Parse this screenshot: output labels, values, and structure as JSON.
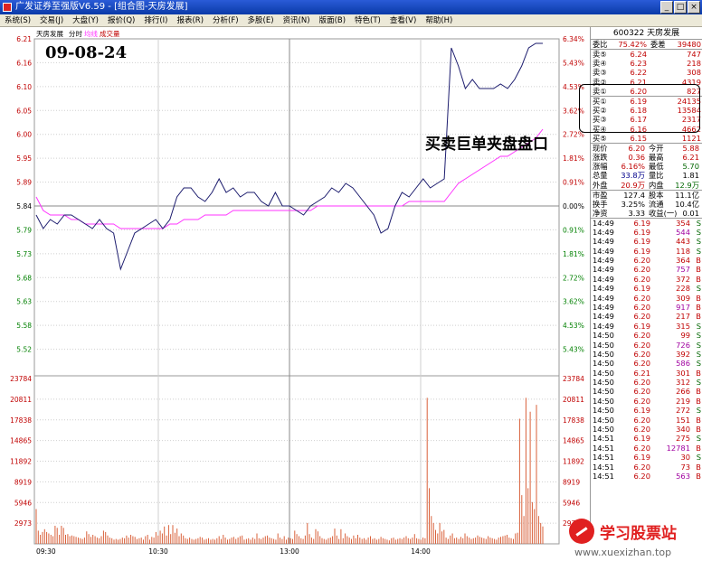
{
  "window": {
    "title": "广发证券至强版V6.59 - [组合图-天房发展]",
    "min": "_",
    "max": "□",
    "close": "×"
  },
  "menu": [
    "系统(S)",
    "交易(J)",
    "大盘(Y)",
    "报价(Q)",
    "排行(I)",
    "报表(R)",
    "分析(F)",
    "多股(E)",
    "资讯(N)",
    "版面(B)",
    "特色(T)",
    "查看(V)",
    "帮助(H)"
  ],
  "chart": {
    "stock_label": "天房发展",
    "tab_fenshi": "分时",
    "tab_junxian": "均线",
    "tab_volume": "成交量",
    "date_annotation": "09-08-24",
    "callout": "买卖巨单夹盘盘口",
    "price_labels": [
      "6.21",
      "6.16",
      "6.10",
      "6.05",
      "6.00",
      "5.95",
      "5.89",
      "5.84",
      "5.79",
      "5.73",
      "5.68",
      "5.63",
      "5.58",
      "5.52"
    ],
    "pct_labels": [
      "6.34%",
      "5.43%",
      "4.53%",
      "3.62%",
      "2.72%",
      "1.81%",
      "0.91%",
      "0.00%",
      "0.91%",
      "1.81%",
      "2.72%",
      "3.62%",
      "4.53%",
      "5.43%"
    ],
    "vol_labels": [
      "23784",
      "20811",
      "17838",
      "14865",
      "11892",
      "8919",
      "5946",
      "2973"
    ],
    "time_labels": [
      "09:30",
      "10:30",
      "13:00",
      "14:00"
    ],
    "colors": {
      "up": "#cc0000",
      "down": "#008000",
      "price_line": "#1c1c6e",
      "avg_line": "#ff33ff",
      "vol_bar": "#d9603a"
    }
  },
  "chart_data": {
    "type": "line",
    "x": [
      "09:30",
      "10:30",
      "13:00",
      "14:00",
      "15:00"
    ],
    "y_price_range": [
      5.47,
      6.21
    ],
    "prev_close": 5.84,
    "series": [
      {
        "values": [
          5.82,
          5.79,
          5.81,
          5.8,
          5.82,
          5.82,
          5.81,
          5.8,
          5.79,
          5.81,
          5.79,
          5.78,
          5.7,
          5.74,
          5.78,
          5.79,
          5.8,
          5.81,
          5.79,
          5.81,
          5.86,
          5.88,
          5.88,
          5.86,
          5.85,
          5.87,
          5.9,
          5.87,
          5.88,
          5.86,
          5.87,
          5.87,
          5.85,
          5.84,
          5.87,
          5.84,
          5.84,
          5.83,
          5.82,
          5.84,
          5.85,
          5.86,
          5.88,
          5.87,
          5.89,
          5.88,
          5.86,
          5.84,
          5.82,
          5.78,
          5.79,
          5.84,
          5.87,
          5.86,
          5.88,
          5.9,
          5.88,
          5.89,
          5.9,
          6.19,
          6.15,
          6.1,
          6.12,
          6.1,
          6.1,
          6.1,
          6.11,
          6.1,
          6.12,
          6.15,
          6.19,
          6.2,
          6.2
        ]
      },
      {
        "values": [
          5.86,
          5.83,
          5.82,
          5.82,
          5.82,
          5.81,
          5.81,
          5.8,
          5.8,
          5.8,
          5.8,
          5.8,
          5.79,
          5.79,
          5.79,
          5.79,
          5.79,
          5.79,
          5.79,
          5.8,
          5.8,
          5.81,
          5.81,
          5.81,
          5.82,
          5.82,
          5.82,
          5.82,
          5.83,
          5.83,
          5.83,
          5.83,
          5.83,
          5.83,
          5.83,
          5.83,
          5.83,
          5.83,
          5.83,
          5.83,
          5.84,
          5.84,
          5.84,
          5.84,
          5.84,
          5.84,
          5.84,
          5.84,
          5.84,
          5.84,
          5.84,
          5.84,
          5.84,
          5.85,
          5.85,
          5.85,
          5.85,
          5.85,
          5.85,
          5.87,
          5.89,
          5.9,
          5.91,
          5.92,
          5.93,
          5.94,
          5.95,
          5.95,
          5.96,
          5.97,
          5.98,
          5.99,
          6.01
        ]
      }
    ],
    "volume": {
      "ylim": [
        0,
        23784
      ],
      "values": [
        5000,
        1900,
        1300,
        1700,
        2100,
        1700,
        1500,
        1300,
        1100,
        2600,
        2300,
        1300,
        2600,
        2300,
        1300,
        1400,
        1100,
        1200,
        1100,
        1000,
        900,
        800,
        700,
        900,
        1800,
        1400,
        1000,
        1300,
        1100,
        900,
        800,
        1100,
        1900,
        1700,
        1200,
        900,
        800,
        600,
        700,
        600,
        700,
        900,
        800,
        1200,
        900,
        1300,
        1100,
        1000,
        700,
        800,
        900,
        600,
        1100,
        1300,
        600,
        1000,
        900,
        1700,
        1200,
        1900,
        1500,
        2500,
        1200,
        2700,
        1400,
        2700,
        1600,
        2200,
        1100,
        1500,
        1200,
        800,
        700,
        900,
        700,
        600,
        700,
        800,
        1000,
        900,
        600,
        700,
        800,
        600,
        700,
        600,
        800,
        1100,
        700,
        1300,
        900,
        600,
        700,
        900,
        1000,
        700,
        900,
        1100,
        1200,
        600,
        700,
        800,
        600,
        900,
        700,
        1500,
        800,
        700,
        900,
        1100,
        1200,
        900,
        800,
        700,
        600,
        1500,
        900,
        700,
        1100,
        600,
        900,
        800,
        700,
        1900,
        1400,
        1100,
        800,
        700,
        1200,
        3000,
        1400,
        900,
        700,
        2100,
        1800,
        1100,
        800,
        700,
        600,
        800,
        900,
        1100,
        2200,
        1200,
        700,
        2100,
        800,
        1500,
        1100,
        900,
        700,
        1200,
        800,
        1300,
        900,
        700,
        800,
        600,
        900,
        1100,
        700,
        800,
        600,
        700,
        1000,
        800,
        700,
        600,
        500,
        800,
        900,
        600,
        700,
        800,
        700,
        900,
        1100,
        800,
        700,
        900,
        1400,
        800,
        700,
        600,
        900,
        800,
        21000,
        8000,
        4000,
        3000,
        2000,
        1500,
        3000,
        1800,
        2000,
        900,
        700,
        1200,
        1500,
        800,
        900,
        700,
        1000,
        800,
        1500,
        1100,
        900,
        700,
        800,
        900,
        1200,
        1000,
        900,
        800,
        700,
        1100,
        900,
        800,
        700,
        600,
        900,
        1000,
        1100,
        1200,
        1300,
        900,
        800,
        700,
        1500,
        1600,
        18000,
        7000,
        4000,
        21000,
        8000,
        19000,
        6000,
        5000,
        20000,
        4000,
        3000,
        2500
      ]
    }
  },
  "panel": {
    "code_title": "600322 天房发展",
    "weibi": {
      "label": "委比",
      "value": "75.42%",
      "label2": "委差",
      "value2": "39480"
    },
    "sells": [
      {
        "label": "卖⑤",
        "price": "6.24",
        "vol": "747"
      },
      {
        "label": "卖④",
        "price": "6.23",
        "vol": "218"
      },
      {
        "label": "卖③",
        "price": "6.22",
        "vol": "308"
      },
      {
        "label": "卖②",
        "price": "6.21",
        "vol": "4319"
      },
      {
        "label": "卖①",
        "price": "6.20",
        "vol": "827"
      }
    ],
    "buys": [
      {
        "label": "买①",
        "price": "6.19",
        "vol": "24135"
      },
      {
        "label": "买②",
        "price": "6.18",
        "vol": "13584"
      },
      {
        "label": "买③",
        "price": "6.17",
        "vol": "2317"
      },
      {
        "label": "买④",
        "price": "6.16",
        "vol": "4662"
      },
      {
        "label": "买⑤",
        "price": "6.15",
        "vol": "1121"
      }
    ],
    "stats": [
      {
        "l1": "现价",
        "v1": "6.20",
        "l2": "今开",
        "v2": "5.88",
        "c1": "red",
        "c2": "red"
      },
      {
        "l1": "涨跌",
        "v1": "0.36",
        "l2": "最高",
        "v2": "6.21",
        "c1": "red",
        "c2": "red"
      },
      {
        "l1": "涨幅",
        "v1": "6.16%",
        "l2": "最低",
        "v2": "5.70",
        "c1": "red",
        "c2": "green"
      },
      {
        "l1": "总量",
        "v1": "33.8万",
        "l2": "量比",
        "v2": "1.81",
        "c1": "blue",
        "c2": "black"
      },
      {
        "l1": "外盘",
        "v1": "20.9万",
        "l2": "内盘",
        "v2": "12.9万",
        "c1": "red",
        "c2": "green"
      }
    ],
    "stats2": [
      {
        "l1": "市盈",
        "v1": "127.4",
        "l2": "股本",
        "v2": "11.1亿"
      },
      {
        "l1": "换手",
        "v1": "3.25%",
        "l2": "流通",
        "v2": "10.4亿"
      },
      {
        "l1": "净资",
        "v1": "3.33",
        "l2": "收益(一)",
        "v2": "0.01"
      }
    ],
    "ticks": [
      {
        "t": "14:49",
        "p": "6.19",
        "v": "354",
        "bs": "S"
      },
      {
        "t": "14:49",
        "p": "6.19",
        "v": "544",
        "bs": "S"
      },
      {
        "t": "14:49",
        "p": "6.19",
        "v": "443",
        "bs": "S"
      },
      {
        "t": "14:49",
        "p": "6.19",
        "v": "118",
        "bs": "S"
      },
      {
        "t": "14:49",
        "p": "6.20",
        "v": "364",
        "bs": "B"
      },
      {
        "t": "14:49",
        "p": "6.20",
        "v": "757",
        "bs": "B"
      },
      {
        "t": "14:49",
        "p": "6.20",
        "v": "372",
        "bs": "B"
      },
      {
        "t": "14:49",
        "p": "6.19",
        "v": "228",
        "bs": "S"
      },
      {
        "t": "14:49",
        "p": "6.20",
        "v": "309",
        "bs": "B"
      },
      {
        "t": "14:49",
        "p": "6.20",
        "v": "917",
        "bs": "B"
      },
      {
        "t": "14:49",
        "p": "6.20",
        "v": "217",
        "bs": "B"
      },
      {
        "t": "14:49",
        "p": "6.19",
        "v": "315",
        "bs": "S"
      },
      {
        "t": "14:50",
        "p": "6.20",
        "v": "99",
        "bs": "S"
      },
      {
        "t": "14:50",
        "p": "6.20",
        "v": "726",
        "bs": "S"
      },
      {
        "t": "14:50",
        "p": "6.20",
        "v": "392",
        "bs": "S"
      },
      {
        "t": "14:50",
        "p": "6.20",
        "v": "586",
        "bs": "S"
      },
      {
        "t": "14:50",
        "p": "6.21",
        "v": "301",
        "bs": "B"
      },
      {
        "t": "14:50",
        "p": "6.20",
        "v": "312",
        "bs": "S"
      },
      {
        "t": "14:50",
        "p": "6.20",
        "v": "266",
        "bs": "B"
      },
      {
        "t": "14:50",
        "p": "6.20",
        "v": "219",
        "bs": "B"
      },
      {
        "t": "14:50",
        "p": "6.19",
        "v": "272",
        "bs": "S"
      },
      {
        "t": "14:50",
        "p": "6.20",
        "v": "151",
        "bs": "B"
      },
      {
        "t": "14:50",
        "p": "6.20",
        "v": "340",
        "bs": "B"
      },
      {
        "t": "14:51",
        "p": "6.19",
        "v": "275",
        "bs": "S"
      },
      {
        "t": "14:51",
        "p": "6.20",
        "v": "12781",
        "bs": "B"
      },
      {
        "t": "14:51",
        "p": "6.19",
        "v": "30",
        "bs": "S"
      },
      {
        "t": "14:51",
        "p": "6.20",
        "v": "73",
        "bs": "B"
      },
      {
        "t": "14:51",
        "p": "6.20",
        "v": "563",
        "bs": "B"
      }
    ]
  },
  "watermark": {
    "title": "学习股票站",
    "url": "www.xuexizhan.top"
  }
}
